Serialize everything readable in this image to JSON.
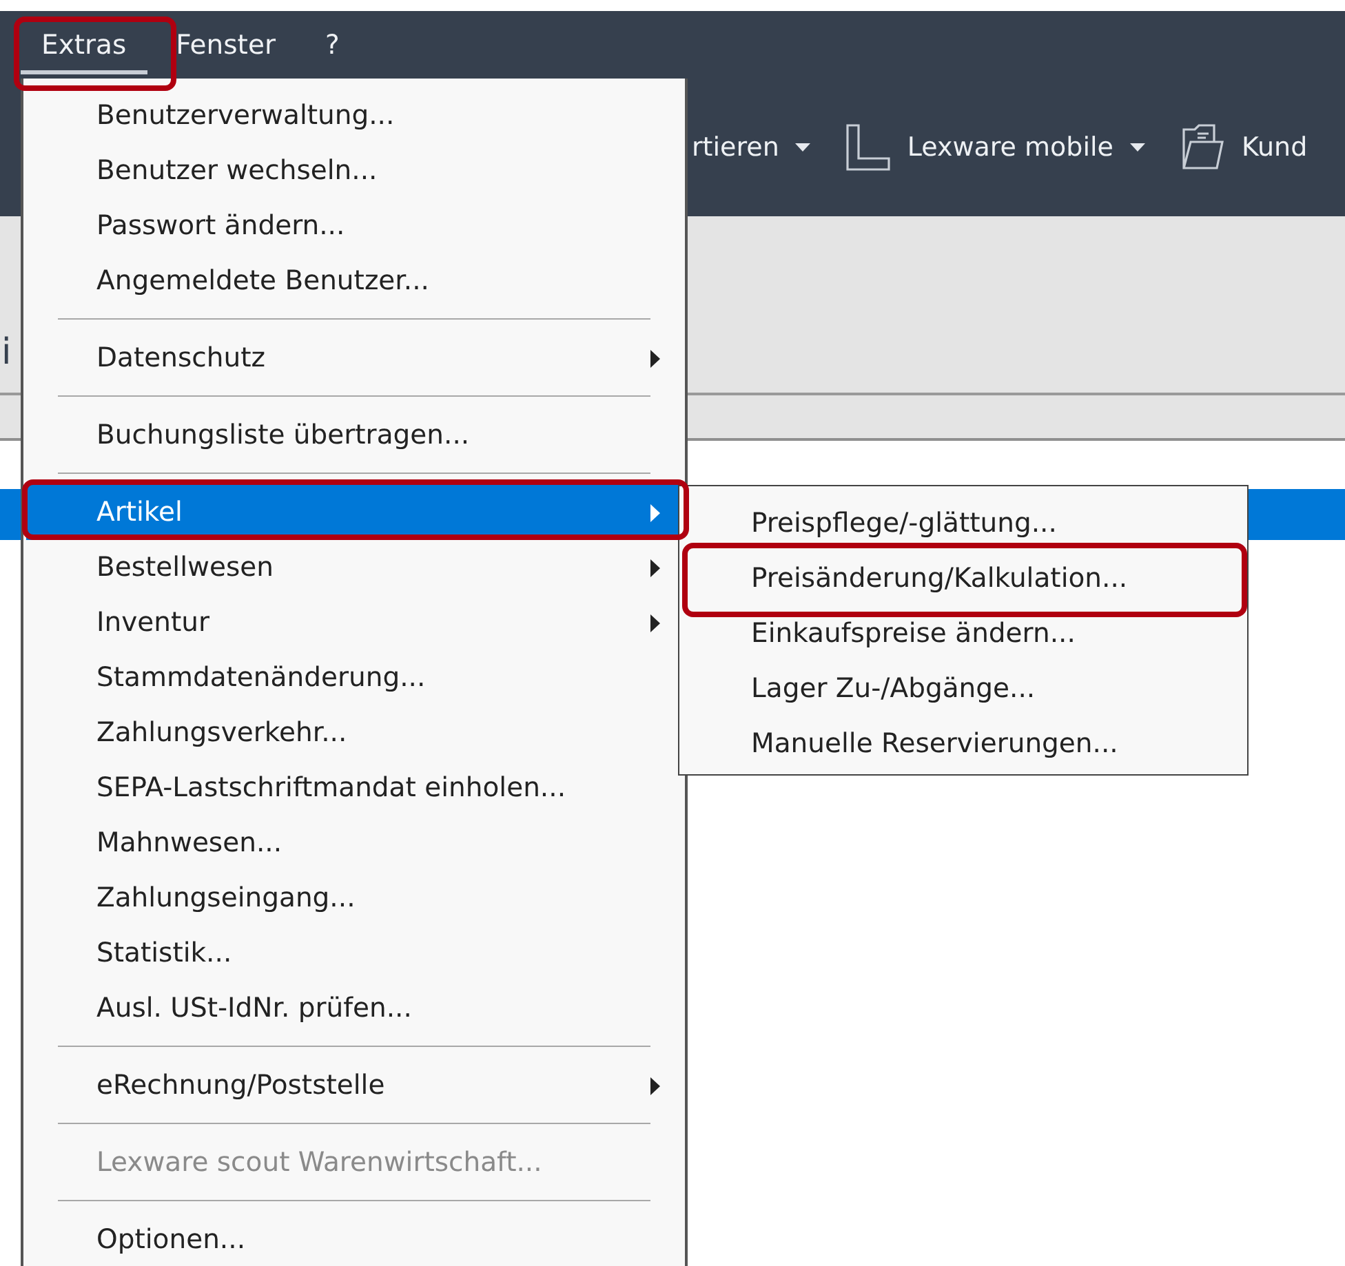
{
  "menubar": [
    {
      "label": "Extras",
      "selected": true,
      "highlighted": true
    },
    {
      "label": "Fenster",
      "selected": false,
      "highlighted": false
    },
    {
      "label": "?",
      "selected": false,
      "highlighted": false
    }
  ],
  "toolbar": [
    {
      "label": "rtieren",
      "dropdown": true
    },
    {
      "label": "Lexware mobile",
      "dropdown": true
    },
    {
      "label": "Kund",
      "dropdown": false
    }
  ],
  "background": {
    "text": "i",
    "row_selected": true
  },
  "menu": {
    "groups": [
      [
        {
          "label": "Benutzerverwaltung...",
          "submenu": false,
          "selected": false,
          "disabled": false,
          "highlighted": false
        },
        {
          "label": "Benutzer wechseln...",
          "submenu": false,
          "selected": false,
          "disabled": false,
          "highlighted": false
        },
        {
          "label": "Passwort ändern...",
          "submenu": false,
          "selected": false,
          "disabled": false,
          "highlighted": false
        },
        {
          "label": "Angemeldete Benutzer...",
          "submenu": false,
          "selected": false,
          "disabled": false,
          "highlighted": false
        }
      ],
      [
        {
          "label": "Datenschutz",
          "submenu": true,
          "selected": false,
          "disabled": false,
          "highlighted": false
        }
      ],
      [
        {
          "label": "Buchungsliste übertragen...",
          "submenu": false,
          "selected": false,
          "disabled": false,
          "highlighted": false
        }
      ],
      [
        {
          "label": "Artikel",
          "submenu": true,
          "selected": true,
          "disabled": false,
          "highlighted": true
        },
        {
          "label": "Bestellwesen",
          "submenu": true,
          "selected": false,
          "disabled": false,
          "highlighted": false
        },
        {
          "label": "Inventur",
          "submenu": true,
          "selected": false,
          "disabled": false,
          "highlighted": false
        },
        {
          "label": "Stammdatenänderung...",
          "submenu": false,
          "selected": false,
          "disabled": false,
          "highlighted": false
        },
        {
          "label": "Zahlungsverkehr...",
          "submenu": false,
          "selected": false,
          "disabled": false,
          "highlighted": false
        },
        {
          "label": "SEPA-Lastschriftmandat einholen...",
          "submenu": false,
          "selected": false,
          "disabled": false,
          "highlighted": false
        },
        {
          "label": "Mahnwesen...",
          "submenu": false,
          "selected": false,
          "disabled": false,
          "highlighted": false
        },
        {
          "label": "Zahlungseingang...",
          "submenu": false,
          "selected": false,
          "disabled": false,
          "highlighted": false
        },
        {
          "label": "Statistik...",
          "submenu": false,
          "selected": false,
          "disabled": false,
          "highlighted": false
        },
        {
          "label": "Ausl. USt-IdNr. prüfen...",
          "submenu": false,
          "selected": false,
          "disabled": false,
          "highlighted": false
        }
      ],
      [
        {
          "label": "eRechnung/Poststelle",
          "submenu": true,
          "selected": false,
          "disabled": false,
          "highlighted": false
        }
      ],
      [
        {
          "label": "Lexware scout Warenwirtschaft...",
          "submenu": false,
          "selected": false,
          "disabled": true,
          "highlighted": false
        }
      ],
      [
        {
          "label": "Optionen...",
          "submenu": false,
          "selected": false,
          "disabled": false,
          "highlighted": false
        }
      ]
    ]
  },
  "submenu": {
    "items": [
      {
        "label": "Preispflege/-glättung...",
        "selected": false,
        "highlighted": false
      },
      {
        "label": "Preisänderung/Kalkulation...",
        "selected": false,
        "highlighted": true
      },
      {
        "label": "Einkaufspreise ändern...",
        "selected": false,
        "highlighted": false
      },
      {
        "label": "Lager Zu-/Abgänge...",
        "selected": false,
        "highlighted": false
      },
      {
        "label": "Manuelle Reservierungen...",
        "selected": false,
        "highlighted": false
      }
    ]
  }
}
